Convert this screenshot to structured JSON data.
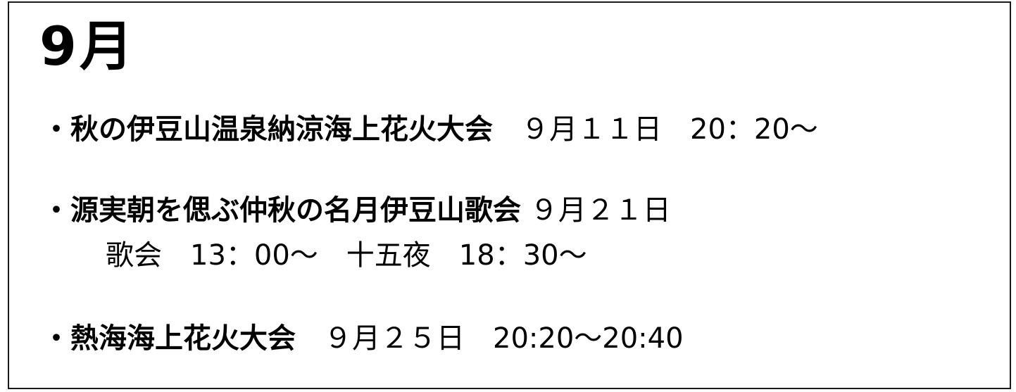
{
  "month_title": "9月",
  "bullet": "・",
  "events": [
    {
      "name": "秋の伊豆山温泉納涼海上花火大会",
      "info": "　９月１１日　20：20～"
    },
    {
      "name": "源実朝を偲ぶ仲秋の名月伊豆山歌会",
      "info": " ９月２１日",
      "sub": "歌会　13：00～　十五夜　18：30～"
    },
    {
      "name": "熱海海上花火大会",
      "info": "　９月２５日　20:20～20:40"
    }
  ]
}
